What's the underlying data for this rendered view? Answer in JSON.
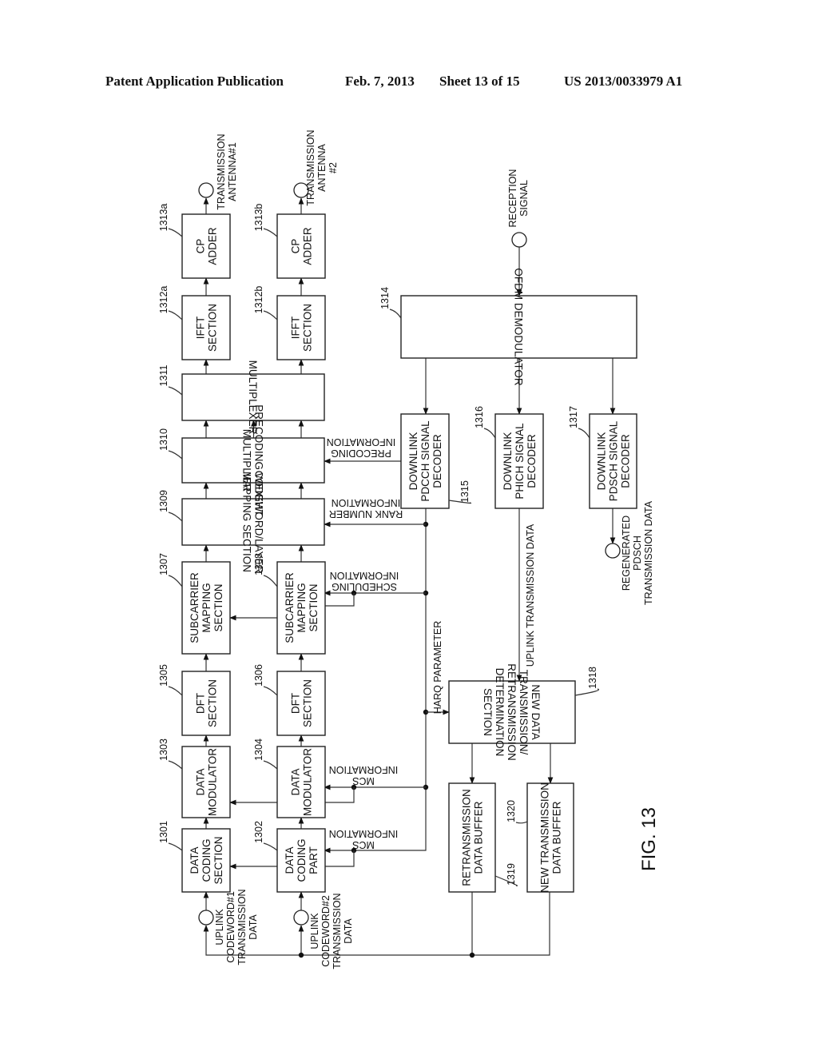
{
  "header": {
    "publication": "Patent Application Publication",
    "date": "Feb. 7, 2013",
    "sheet": "Sheet 13 of 15",
    "number": "US 2013/0033979 A1"
  },
  "figure_label": "FIG. 13",
  "blocks": {
    "b1301": {
      "ref": "1301",
      "lines": [
        "DATA",
        "CODING",
        "SECTION"
      ]
    },
    "b1302": {
      "ref": "1302",
      "lines": [
        "DATA",
        "CODING",
        "PART"
      ]
    },
    "b1303": {
      "ref": "1303",
      "lines": [
        "DATA",
        "MODULATOR"
      ]
    },
    "b1304": {
      "ref": "1304",
      "lines": [
        "DATA",
        "MODULATOR"
      ]
    },
    "b1305": {
      "ref": "1305",
      "lines": [
        "DFT",
        "SECTION"
      ]
    },
    "b1306": {
      "ref": "1306",
      "lines": [
        "DFT",
        "SECTION"
      ]
    },
    "b1307": {
      "ref": "1307",
      "lines": [
        "SUBCARRIER",
        "MAPPING",
        "SECTION"
      ]
    },
    "b1308": {
      "ref": "1308",
      "lines": [
        "SUBCARRIER",
        "MAPPING",
        "SECTION"
      ]
    },
    "b1309": {
      "ref": "1309",
      "lines": [
        "CODEWORD/LAYER",
        "MAPPING SECTION"
      ]
    },
    "b1310": {
      "ref": "1310",
      "lines": [
        "PRECODING WEIGHT",
        "MULTIPLIER"
      ]
    },
    "b1311": {
      "ref": "1311",
      "lines": [
        "MULTIPLEXER"
      ]
    },
    "b1312a": {
      "ref": "1312a",
      "lines": [
        "IFFT",
        "SECTION"
      ]
    },
    "b1312b": {
      "ref": "1312b",
      "lines": [
        "IFFT",
        "SECTION"
      ]
    },
    "b1313a": {
      "ref": "1313a",
      "lines": [
        "CP",
        "ADDER"
      ]
    },
    "b1313b": {
      "ref": "1313b",
      "lines": [
        "CP",
        "ADDER"
      ]
    },
    "b1314": {
      "ref": "1314",
      "lines": [
        "OFDM DEMODULATOR"
      ]
    },
    "b1315": {
      "ref": "1315",
      "lines": [
        "DOWNLINK",
        "PDCCH SIGNAL",
        "DECODER"
      ]
    },
    "b1316": {
      "ref": "1316",
      "lines": [
        "DOWNLINK",
        "PHICH SIGNAL",
        "DECODER"
      ]
    },
    "b1317": {
      "ref": "1317",
      "lines": [
        "DOWNLINK",
        "PDSCH SIGNAL",
        "DECODER"
      ]
    },
    "b1318": {
      "ref": "1318",
      "lines": [
        "NEW DATA",
        "TRANSMISSION/",
        "RETRANSMISSION",
        "DETERMINATION",
        "SECTION"
      ]
    },
    "b1319": {
      "ref": "1319",
      "lines": [
        "RETRANSMISSION",
        "DATA BUFFER"
      ]
    },
    "b1320": {
      "ref": "1320",
      "lines": [
        "NEW TRANSMISSION",
        "DATA BUFFER"
      ]
    }
  },
  "signals": {
    "antenna1": [
      "TRANSMISSION",
      "ANTENNA#1"
    ],
    "antenna2": [
      "TRANSMISSION",
      "ANTENNA",
      "#2"
    ],
    "reception": [
      "RECEPTION",
      "SIGNAL"
    ],
    "precoding_info": [
      "PRECODING",
      "INFORMATION"
    ],
    "rank_info": [
      "RANK NUMBER",
      "INFORMATION"
    ],
    "scheduling_info": [
      "SCHEDULING",
      "INFORMATION"
    ],
    "mcs_info_mod": [
      "MCS",
      "INFORMATION"
    ],
    "mcs_info_coding": [
      "MCS",
      "INFORMATION"
    ],
    "harq": "HARQ PARAMETER",
    "uplink_tx": "UPLINK TRANSMISSION DATA",
    "regenerated": [
      "REGENERATED",
      "PDSCH",
      "TRANSMISSION DATA"
    ],
    "codeword1": [
      "UPLINK",
      "CODEWORD#1",
      "TRANSMISSION",
      "DATA"
    ],
    "codeword2": [
      "UPLINK",
      "CODEWORD#2",
      "TRANSMISSION",
      "DATA"
    ]
  }
}
